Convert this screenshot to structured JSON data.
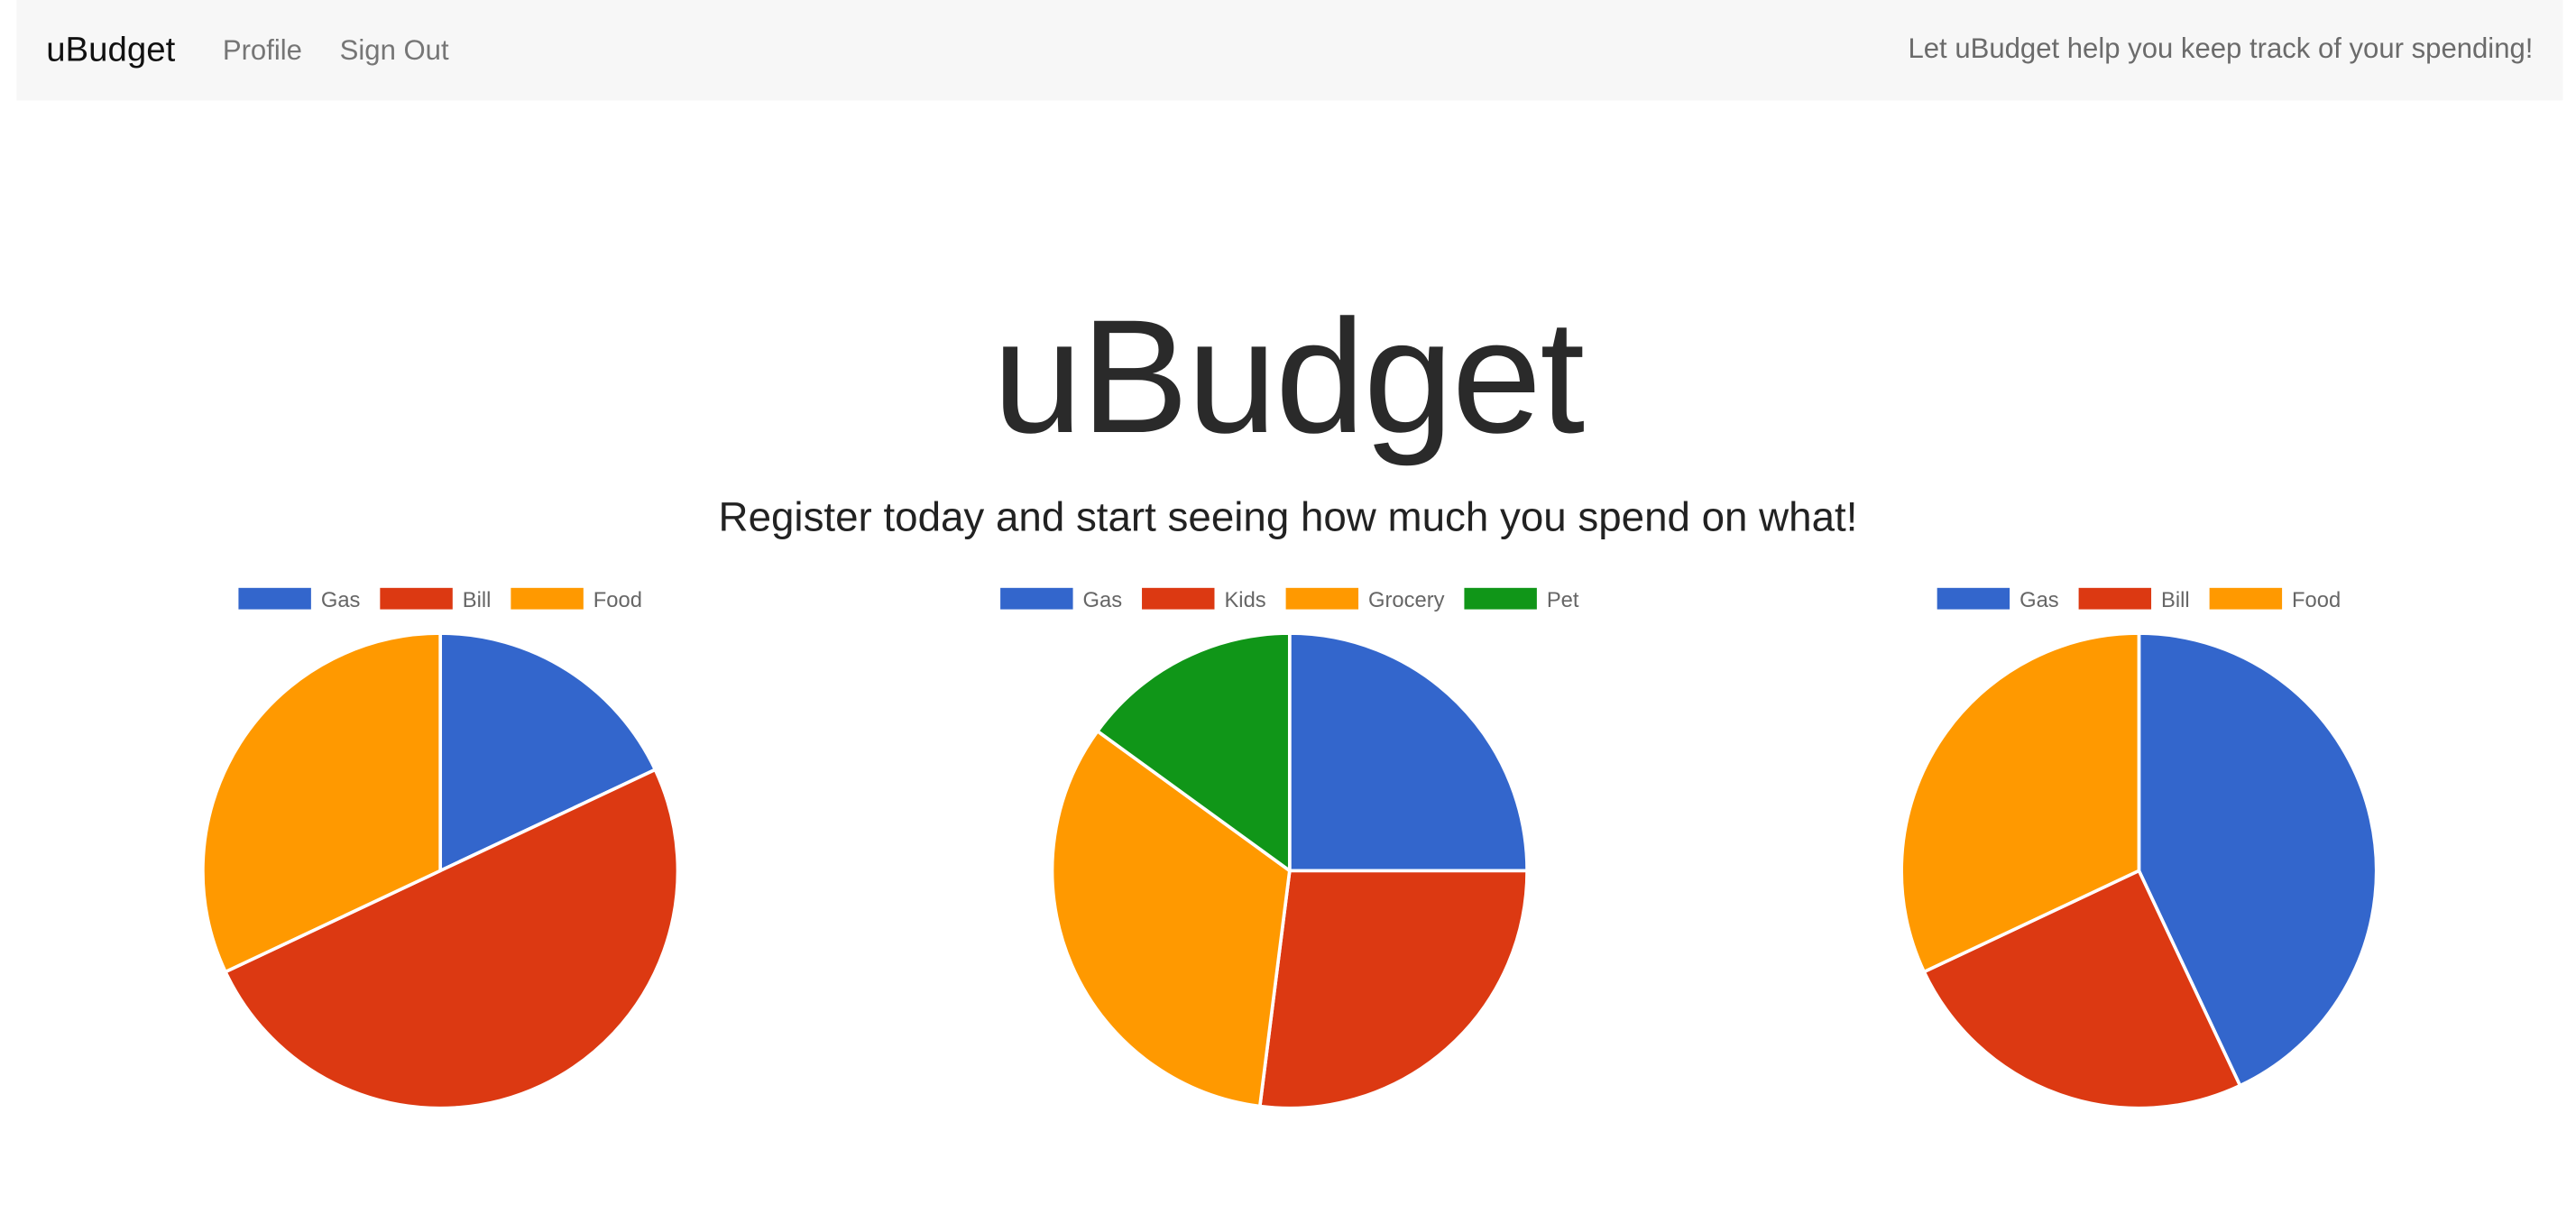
{
  "navbar": {
    "brand": "uBudget",
    "links": [
      {
        "label": "Profile"
      },
      {
        "label": "Sign Out"
      }
    ],
    "tagline": "Let uBudget help you keep track of your spending!"
  },
  "hero": {
    "title": "uBudget",
    "subtitle": "Register today and start seeing how much you spend on what!"
  },
  "chart_data": [
    {
      "type": "pie",
      "legend_position": "top",
      "categories": [
        "Gas",
        "Bill",
        "Food"
      ],
      "values": [
        18,
        50,
        32
      ],
      "colors": [
        "#3366cc",
        "#dc3912",
        "#ff9900"
      ]
    },
    {
      "type": "pie",
      "legend_position": "top",
      "categories": [
        "Gas",
        "Kids",
        "Grocery",
        "Pet"
      ],
      "values": [
        25,
        27,
        33,
        15
      ],
      "colors": [
        "#3366cc",
        "#dc3912",
        "#ff9900",
        "#109618"
      ]
    },
    {
      "type": "pie",
      "legend_position": "top",
      "categories": [
        "Gas",
        "Bill",
        "Food"
      ],
      "values": [
        43,
        25,
        32
      ],
      "colors": [
        "#3366cc",
        "#dc3912",
        "#ff9900"
      ]
    }
  ]
}
